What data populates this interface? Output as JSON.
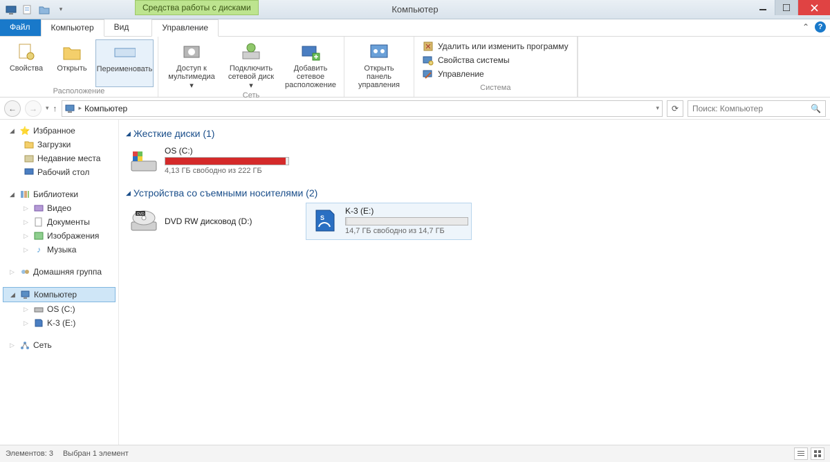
{
  "title_context": "Средства работы с дисками",
  "window_title": "Компьютер",
  "tabs": {
    "file": "Файл",
    "computer": "Компьютер",
    "view": "Вид",
    "manage": "Управление"
  },
  "ribbon": {
    "location": {
      "properties": "Свойства",
      "open": "Открыть",
      "rename": "Переименовать",
      "group": "Расположение"
    },
    "network": {
      "media": "Доступ к мультимедиа",
      "mapdrive": "Подключить сетевой диск",
      "addloc": "Добавить сетевое расположение",
      "group": "Сеть"
    },
    "system_panel": "Открыть панель управления",
    "system_rows": {
      "uninstall": "Удалить или изменить программу",
      "sysprops": "Свойства системы",
      "manage": "Управление"
    },
    "system_group": "Система"
  },
  "breadcrumb": "Компьютер",
  "search_placeholder": "Поиск: Компьютер",
  "sidebar": {
    "favorites": "Избранное",
    "downloads": "Загрузки",
    "recent": "Недавние места",
    "desktop": "Рабочий стол",
    "libraries": "Библиотеки",
    "video": "Видео",
    "documents": "Документы",
    "pictures": "Изображения",
    "music": "Музыка",
    "homegroup": "Домашняя группа",
    "computer": "Компьютер",
    "os": "OS (C:)",
    "k3": "K-3 (E:)",
    "network": "Сеть"
  },
  "content": {
    "hdd_header": "Жесткие диски (1)",
    "os_name": "OS (C:)",
    "os_status": "4,13 ГБ свободно из 222 ГБ",
    "os_fill_pct": 98,
    "removable_header": "Устройства со съемными носителями (2)",
    "dvd_name": "DVD RW дисковод (D:)",
    "k3_name": "K-3 (E:)",
    "k3_status": "14,7 ГБ свободно из 14,7 ГБ",
    "k3_fill_pct": 1
  },
  "status": {
    "items": "Элементов: 3",
    "selected": "Выбран 1 элемент"
  }
}
